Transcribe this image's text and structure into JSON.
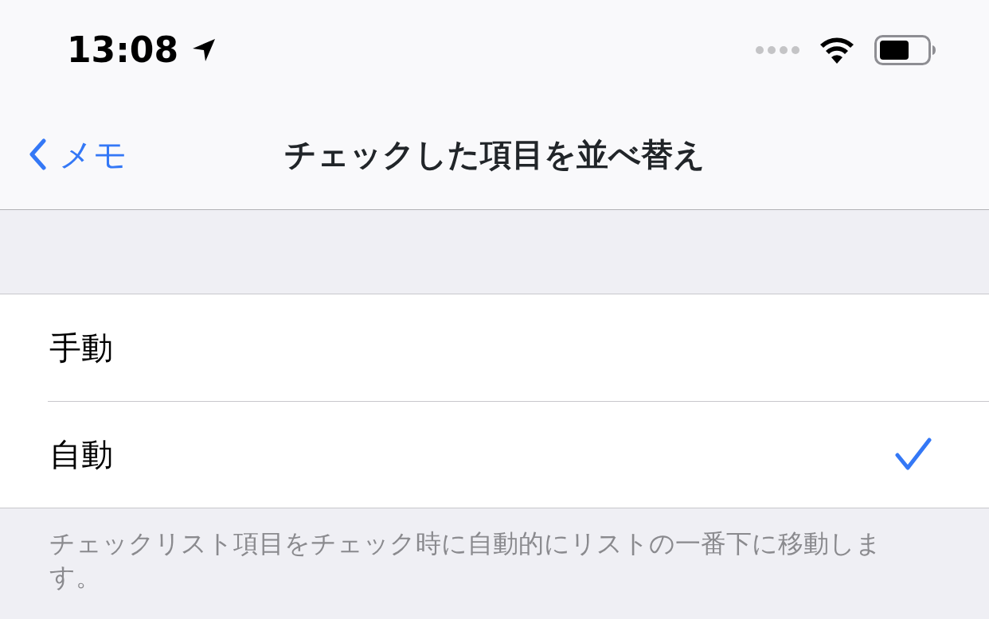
{
  "status_bar": {
    "time": "13:08"
  },
  "nav": {
    "back": "メモ",
    "title": "チェックした項目を並べ替え"
  },
  "options": [
    {
      "label": "手動",
      "selected": false
    },
    {
      "label": "自動",
      "selected": true
    }
  ],
  "footer": "チェックリスト項目をチェック時に自動的にリストの一番下に移動します。"
}
